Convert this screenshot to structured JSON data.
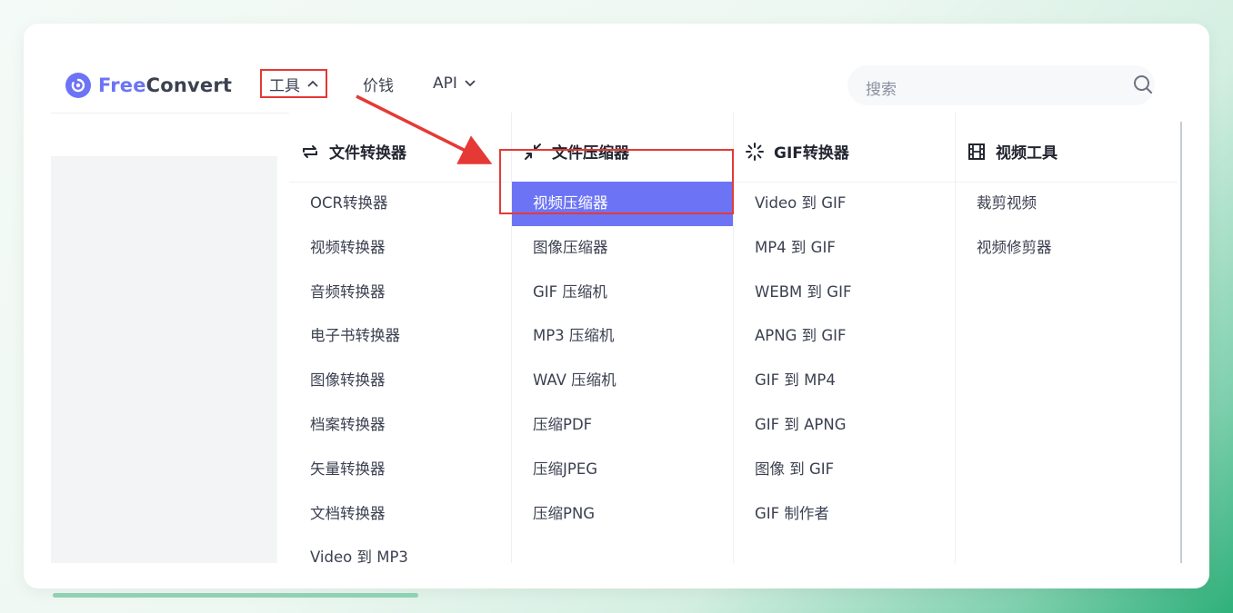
{
  "brand": {
    "name_part1": "Free",
    "name_part2": "Convert"
  },
  "nav": {
    "tools": "工具",
    "price": "价钱",
    "api": "API"
  },
  "search": {
    "placeholder": "搜索"
  },
  "menu": {
    "columns": [
      {
        "title": "文件转换器",
        "icon": "convert-arrows-icon",
        "items": [
          "OCR转换器",
          "视频转换器",
          "音频转换器",
          "电子书转换器",
          "图像转换器",
          "档案转换器",
          "矢量转换器",
          "文档转换器",
          "Video 到 MP3"
        ]
      },
      {
        "title": "文件压缩器",
        "icon": "compress-arrows-icon",
        "items": [
          "视频压缩器",
          "图像压缩器",
          "GIF 压缩机",
          "MP3 压缩机",
          "WAV 压缩机",
          "压缩PDF",
          "压缩JPEG",
          "压缩PNG"
        ],
        "active_index": 0
      },
      {
        "title": "GIF转换器",
        "icon": "loader-sparkle-icon",
        "items": [
          "Video 到 GIF",
          "MP4 到 GIF",
          "WEBM 到 GIF",
          "APNG 到 GIF",
          "GIF 到 MP4",
          "GIF 到 APNG",
          "图像 到 GIF",
          "GIF 制作者"
        ]
      },
      {
        "title": "视频工具",
        "icon": "film-icon",
        "items": [
          "裁剪视频",
          "视频修剪器"
        ]
      }
    ]
  },
  "colors": {
    "accent": "#6c74f5",
    "highlight_border": "#e53935",
    "text": "#3c4151"
  }
}
